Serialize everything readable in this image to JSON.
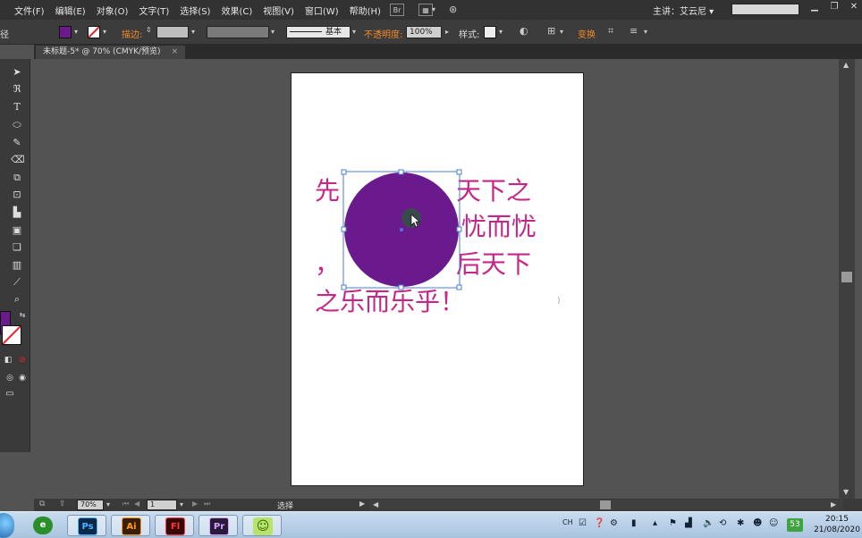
{
  "menubar": {
    "items": [
      "文件(F)",
      "编辑(E)",
      "对象(O)",
      "文字(T)",
      "选择(S)",
      "效果(C)",
      "视图(V)",
      "窗口(W)",
      "帮助(H)"
    ],
    "bridge_label": "Br",
    "workspace": "主讲：艾云尼 ▾",
    "search_placeholder": ""
  },
  "controlbar": {
    "left_label": "径",
    "stroke_label": "描边:",
    "brush_label": "基本",
    "opacity_label": "不透明度:",
    "opacity_value": "100%",
    "style_label": "样式:",
    "transform_label": "变换",
    "fill_color": "#6a1a8c"
  },
  "document": {
    "tab_title": "未标题-5* @ 70% (CMYK/预览)",
    "close_glyph": "×"
  },
  "artwork": {
    "line1_left": "先",
    "line1_right": "天下之",
    "line2_right": "忧而忧",
    "line3_left": "，",
    "line3_right": "后天下",
    "line4": "之乐而乐乎！",
    "circle_color": "#6a1a8c",
    "text_color": "#c42786"
  },
  "statusbar": {
    "zoom": "70%",
    "page": "1",
    "mode": "选择"
  },
  "taskbar": {
    "apps": [
      {
        "name": "ie",
        "label": "e",
        "bg": "#2a8f2a",
        "fg": "#fff"
      },
      {
        "name": "photoshop",
        "label": "Ps",
        "bg": "#0b2a4a",
        "fg": "#4fb3ff"
      },
      {
        "name": "illustrator",
        "label": "Ai",
        "bg": "#3b1e06",
        "fg": "#ff9a1f"
      },
      {
        "name": "flash",
        "label": "Fl",
        "bg": "#3a0606",
        "fg": "#ff3b3b"
      },
      {
        "name": "premiere",
        "label": "Pr",
        "bg": "#2a1a3a",
        "fg": "#d8a6ff"
      },
      {
        "name": "smiley",
        "label": "☺",
        "bg": "#b9e26a",
        "fg": "#2f6b00"
      }
    ],
    "lang": "CH",
    "badge": "53",
    "time": "20:15",
    "date": "21/08/2020"
  }
}
